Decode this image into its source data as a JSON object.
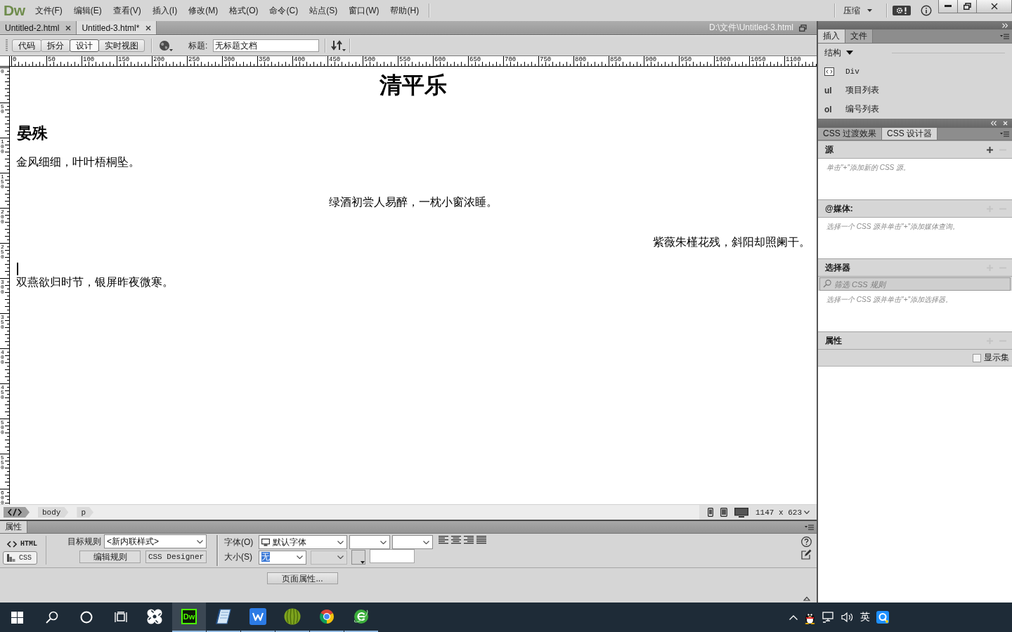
{
  "app_bar": {
    "logo": "Dw",
    "menus": [
      "文件(F)",
      "编辑(E)",
      "查看(V)",
      "插入(I)",
      "修改(M)",
      "格式(O)",
      "命令(C)",
      "站点(S)",
      "窗口(W)",
      "帮助(H)"
    ],
    "workspace": "压缩"
  },
  "document_tabs": [
    {
      "label": "Untitled-2.html",
      "selected": false
    },
    {
      "label": "Untitled-3.html*",
      "selected": true
    }
  ],
  "file_path": "D:\\文件\\Untitled-3.html",
  "doc_toolbar": {
    "view_buttons": [
      {
        "label": "代码",
        "selected": false
      },
      {
        "label": "拆分",
        "selected": false
      },
      {
        "label": "设计",
        "selected": true
      },
      {
        "label": "实时视图",
        "selected": false
      }
    ],
    "title_label": "标题:",
    "title_value": "无标题文档"
  },
  "rulers": {
    "horizontal": [
      "0",
      "50",
      "100",
      "150",
      "200",
      "250",
      "300",
      "350",
      "400",
      "450",
      "500",
      "550",
      "600",
      "650",
      "700",
      "750",
      "800",
      "850",
      "900",
      "950",
      "1000",
      "1050",
      "1100"
    ],
    "vertical": [
      "0",
      "50",
      "100",
      "150",
      "200",
      "250",
      "300",
      "350",
      "400",
      "450",
      "500",
      "550",
      "600"
    ]
  },
  "document": [
    {
      "kind": "title",
      "text": "清平乐",
      "cursor": false
    },
    {
      "kind": "heading",
      "text": "晏殊",
      "cursor": false
    },
    {
      "kind": "paragraph",
      "text": "金风细细，叶叶梧桐坠。",
      "cursor": false
    },
    {
      "kind": "centered",
      "text": "绿酒初尝人易醉，一枕小窗浓睡。",
      "cursor": false
    },
    {
      "kind": "flushright",
      "text": "紫薇朱槿花残，斜阳却照阑干。",
      "cursor": false
    },
    {
      "kind": "paragraph",
      "text": "双燕欲归时节，银屏昨夜微寒。",
      "cursor": true
    }
  ],
  "status_bar": {
    "tags": [
      "body",
      "p"
    ],
    "window_size": "1147 x 623"
  },
  "properties": {
    "tab": "属性",
    "modes": [
      {
        "label": "HTML",
        "selected": false
      },
      {
        "label": "CSS",
        "selected": true
      }
    ],
    "target_rule": {
      "label": "目标规则",
      "value": "<新内联样式>"
    },
    "rule_buttons": [
      "编辑规则",
      "CSS Designer"
    ],
    "font": {
      "label": "字体(O)",
      "value": "默认字体",
      "extra_selects": [
        {
          "disabled": false
        },
        {
          "disabled": false
        }
      ]
    },
    "size": {
      "label": "大小(S)",
      "value": "无",
      "value_highlighted": true,
      "unit_select": {
        "disabled": true
      }
    },
    "page_properties": "页面属性..."
  },
  "insert_panel": {
    "tabs": [
      {
        "label": "插入",
        "selected": true
      },
      {
        "label": "文件",
        "selected": false
      }
    ],
    "category": "结构",
    "items": [
      {
        "kind": "box",
        "label": "Div"
      },
      {
        "kind": "abbr",
        "abbr": "ul",
        "label": "项目列表"
      },
      {
        "kind": "abbr",
        "abbr": "ol",
        "label": "编号列表"
      }
    ]
  },
  "css_panel": {
    "tabs": [
      {
        "label": "CSS 过渡效果",
        "selected": false
      },
      {
        "label": "CSS 设计器",
        "selected": true
      }
    ],
    "sections": [
      {
        "kind": "plain",
        "title": "源",
        "add_enabled": true,
        "hint": "单击\"+\"添加新的 CSS 源。"
      },
      {
        "kind": "plain",
        "title": "@媒体:",
        "add_enabled": false,
        "hint": "选择一个 CSS 源并单击\"+\"添加媒体查询。"
      },
      {
        "kind": "filter",
        "title": "选择器",
        "add_enabled": false,
        "placeholder": "筛选 CSS 规则",
        "hint": "选择一个 CSS 源并单击\"+\"添加选择器。"
      },
      {
        "kind": "properties",
        "title": "属性",
        "add_enabled": false,
        "show_set": {
          "label": "显示集",
          "checked": false
        }
      }
    ]
  },
  "taskbar": {
    "apps": [
      {
        "kind": "pinwheel",
        "running": false,
        "selected": false
      },
      {
        "kind": "dw",
        "label": "Dw",
        "running": true,
        "selected": true
      },
      {
        "kind": "notebook",
        "running": true,
        "selected": false
      },
      {
        "kind": "zigzag",
        "running": true,
        "selected": false
      },
      {
        "kind": "ball",
        "running": true,
        "selected": false
      },
      {
        "kind": "ring",
        "running": true,
        "selected": false
      },
      {
        "kind": "swirl",
        "running": true,
        "selected": false
      }
    ],
    "input_language": "英"
  }
}
